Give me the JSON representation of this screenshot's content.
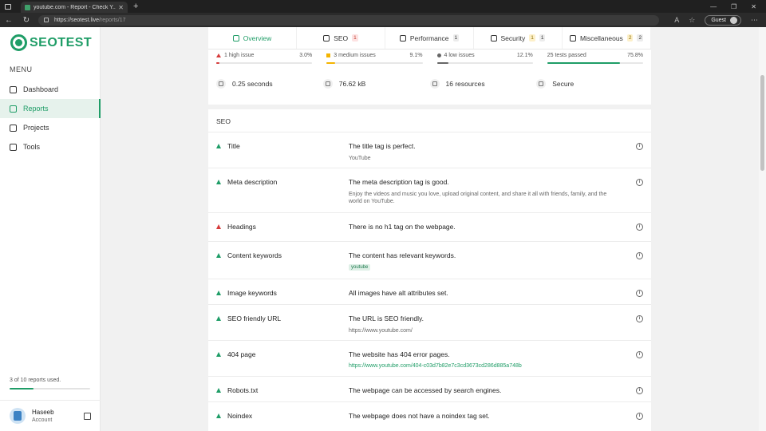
{
  "browser": {
    "tab_title": "youtube.com - Report - Check Y...",
    "new_tab": "+",
    "url_host": "https://seotest.live",
    "url_path": "/reports/17",
    "profile": "Guest"
  },
  "sidebar": {
    "logo": "SEOTEST",
    "menu_label": "MENU",
    "items": [
      {
        "label": "Dashboard",
        "icon": "dashboard-icon"
      },
      {
        "label": "Reports",
        "icon": "reports-icon"
      },
      {
        "label": "Projects",
        "icon": "projects-icon"
      },
      {
        "label": "Tools",
        "icon": "tools-icon"
      }
    ],
    "active": "Reports",
    "usage_text": "3 of 10 reports used.",
    "usage_fraction": 0.3,
    "user": {
      "name": "Haseeb",
      "role": "Account"
    }
  },
  "tabs": [
    {
      "label": "Overview",
      "icon": "overview-icon"
    },
    {
      "label": "SEO",
      "icon": "search-icon",
      "badges": [
        "1"
      ]
    },
    {
      "label": "Performance",
      "icon": "gauge-icon",
      "badges": [
        "1"
      ]
    },
    {
      "label": "Security",
      "icon": "shield-icon",
      "badges": [
        "1",
        "1"
      ]
    },
    {
      "label": "Miscellaneous",
      "icon": "misc-icon",
      "badges": [
        "2",
        "2"
      ]
    }
  ],
  "issues": [
    {
      "label": "1 high issue",
      "pct": "3.0%",
      "value": 3.0,
      "color": "#d63b3b"
    },
    {
      "label": "3 medium issues",
      "pct": "9.1%",
      "value": 9.1,
      "color": "#f4b400"
    },
    {
      "label": "4 low issues",
      "pct": "12.1%",
      "value": 12.1,
      "color": "#666666"
    },
    {
      "label": "25 tests passed",
      "pct": "75.8%",
      "value": 75.8,
      "color": "#1f9d67"
    }
  ],
  "stats": [
    {
      "value": "0.25 seconds",
      "icon": "clock-icon"
    },
    {
      "value": "76.62 kB",
      "icon": "weight-icon"
    },
    {
      "value": "16 resources",
      "icon": "resources-icon"
    },
    {
      "value": "Secure",
      "icon": "lock-icon"
    }
  ],
  "seo": {
    "heading": "SEO",
    "rows": [
      {
        "name": "Title",
        "status": "pass",
        "message": "The title tag is perfect.",
        "detail": "YouTube"
      },
      {
        "name": "Meta description",
        "status": "pass",
        "message": "The meta description tag is good.",
        "detail": "Enjoy the videos and music you love, upload original content, and share it all with friends, family, and the world on YouTube."
      },
      {
        "name": "Headings",
        "status": "fail",
        "message": "There is no h1 tag on the webpage."
      },
      {
        "name": "Content keywords",
        "status": "pass",
        "message": "The content has relevant keywords.",
        "keyword": "youtube"
      },
      {
        "name": "Image keywords",
        "status": "pass",
        "message": "All images have alt attributes set."
      },
      {
        "name": "SEO friendly URL",
        "status": "pass",
        "message": "The URL is SEO friendly.",
        "detail": "https://www.youtube.com/"
      },
      {
        "name": "404 page",
        "status": "pass",
        "message": "The website has 404 error pages.",
        "link": "https://www.youtube.com/404-c03d7b82e7c3cd3673cd286d885a748b"
      },
      {
        "name": "Robots.txt",
        "status": "pass",
        "message": "The webpage can be accessed by search engines."
      },
      {
        "name": "Noindex",
        "status": "pass",
        "message": "The webpage does not have a noindex tag set."
      }
    ]
  }
}
